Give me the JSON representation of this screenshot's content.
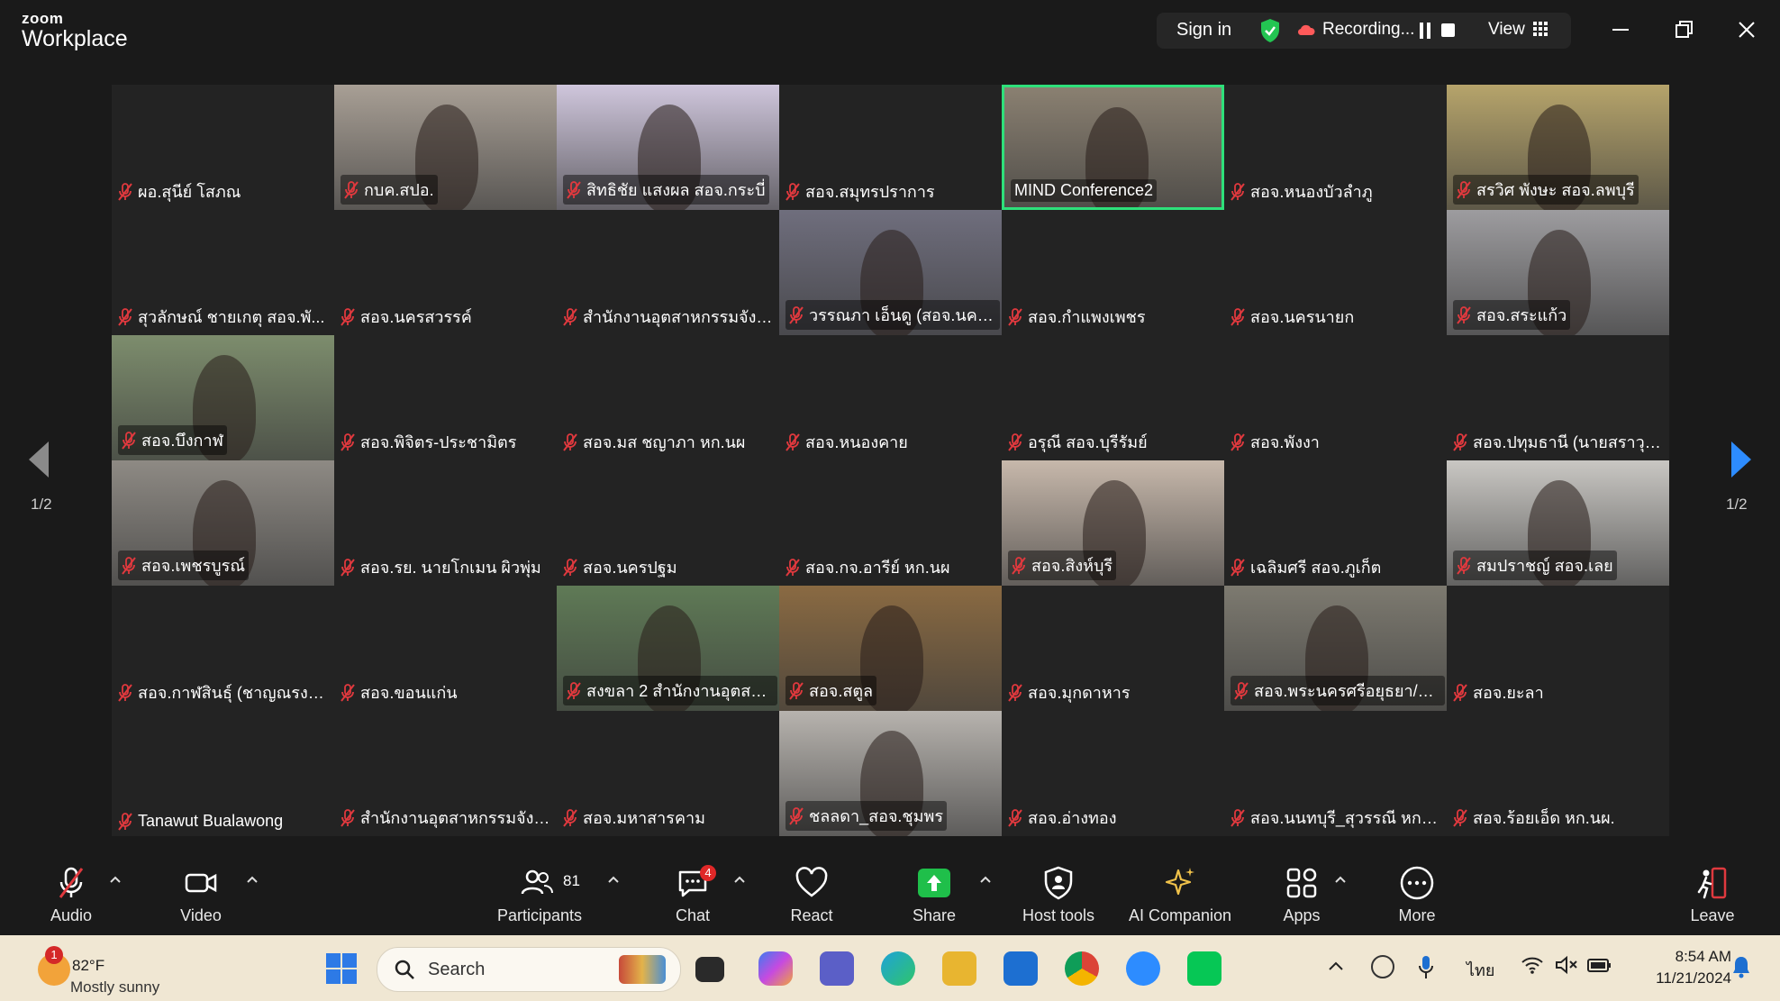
{
  "app": {
    "brand_small": "zoom",
    "brand_large": "Workplace"
  },
  "topbar": {
    "sign_in": "Sign in",
    "recording": "Recording...",
    "view": "View"
  },
  "colors": {
    "active_border": "#2ee07a",
    "mic_muted": "#e0393e",
    "share_green": "#1fbf4a",
    "accent_blue": "#2d8cff"
  },
  "gallery": {
    "page": "1/2",
    "tiles": [
      {
        "name": "ผอ.สุนีย์ โสภณ",
        "video": false
      },
      {
        "name": "กบค.สปอ.",
        "video": true,
        "bg": "#a89f95"
      },
      {
        "name": "สิทธิชัย  แสงผล สอจ.กระบี่",
        "video": true,
        "bg": "#cfc6dc"
      },
      {
        "name": "สอจ.สมุทรปราการ",
        "video": false
      },
      {
        "name": "MIND Conference2",
        "video": true,
        "bg": "#8a8071",
        "active": true,
        "nomic": true
      },
      {
        "name": "สอจ.หนองบัวลำภู",
        "video": false
      },
      {
        "name": "สรวิศ พังษะ สอจ.ลพบุรี",
        "video": true,
        "bg": "#b6a46b"
      },
      {
        "name": "สุวลักษณ์ ชายเกตุ สอจ.พั...",
        "video": false
      },
      {
        "name": "สอจ.นครสวรรค์",
        "video": false
      },
      {
        "name": "สำนักงานอุตสาหกรรมจังห...",
        "video": false
      },
      {
        "name": "วรรณภา เอ็นดู (สอจ.นคร...",
        "video": true,
        "bg": "#6f6e7d"
      },
      {
        "name": "สอจ.กำแพงเพชร",
        "video": false
      },
      {
        "name": "สอจ.นครนายก",
        "video": false
      },
      {
        "name": "สอจ.สระแก้ว",
        "video": true,
        "bg": "#9d9c9f"
      },
      {
        "name": "สอจ.บึงกาฬ",
        "video": true,
        "bg": "#7d8d6d"
      },
      {
        "name": "สอจ.พิจิตร-ประชามิตร",
        "video": false
      },
      {
        "name": "สอจ.มส ชญาภา หก.นผ",
        "video": false
      },
      {
        "name": "สอจ.หนองคาย",
        "video": false
      },
      {
        "name": "อรุณี สอจ.บุรีรัมย์",
        "video": false
      },
      {
        "name": "สอจ.พังงา",
        "video": false
      },
      {
        "name": "สอจ.ปทุมธานี (นายสราวุธ ...",
        "video": false
      },
      {
        "name": "สอจ.เพชรบูรณ์",
        "video": true,
        "bg": "#8e8a84"
      },
      {
        "name": "สอจ.รย. นายโกเมน ผิวพุ่ม",
        "video": false
      },
      {
        "name": "สอจ.นครปฐม",
        "video": false
      },
      {
        "name": "สอจ.กจ.อารีย์ หก.นผ",
        "video": false
      },
      {
        "name": "สอจ.สิงห์บุรี",
        "video": true,
        "bg": "#c7b8ab"
      },
      {
        "name": "เฉลิมศรี สอจ.ภูเก็ต",
        "video": false
      },
      {
        "name": "สมปราชญ์ สอจ.เลย",
        "video": true,
        "bg": "#c9c7c3"
      },
      {
        "name": "สอจ.กาฬสินธุ์ (ชาญณรงค์...",
        "video": false
      },
      {
        "name": "สอจ.ขอนแก่น",
        "video": false
      },
      {
        "name": "สงขลา 2 สำนักงานอุตสาห...",
        "video": true,
        "bg": "#5f7a56"
      },
      {
        "name": "สอจ.สตูล",
        "video": true,
        "bg": "#8a6a42"
      },
      {
        "name": "สอจ.มุกดาหาร",
        "video": false
      },
      {
        "name": "สอจ.พระนครศรีอยุธยา/สา...",
        "video": true,
        "bg": "#7d7a70"
      },
      {
        "name": "สอจ.ยะลา",
        "video": false
      },
      {
        "name": "Tanawut Bualawong",
        "video": false
      },
      {
        "name": "สำนักงานอุตสาหกรรมจังห...",
        "video": false
      },
      {
        "name": "สอจ.มหาสารคาม",
        "video": false
      },
      {
        "name": "ชลลดา_สอจ.ชุมพร",
        "video": true,
        "bg": "#b7b3ae"
      },
      {
        "name": "สอจ.อ่างทอง",
        "video": false
      },
      {
        "name": "สอจ.นนทบุรี_สุวรรณี หก.นผ.",
        "video": false
      },
      {
        "name": "สอจ.ร้อยเอ็ด หก.นผ.",
        "video": false
      }
    ]
  },
  "toolbar": {
    "audio": "Audio",
    "video": "Video",
    "participants": "Participants",
    "participants_count": "81",
    "chat": "Chat",
    "chat_badge": "4",
    "react": "React",
    "share": "Share",
    "host_tools": "Host tools",
    "ai_companion": "AI Companion",
    "apps": "Apps",
    "more": "More",
    "leave": "Leave"
  },
  "taskbar": {
    "weather_badge": "1",
    "temperature": "82°F",
    "weather": "Mostly sunny",
    "search_placeholder": "Search",
    "language": "ไทย",
    "time": "8:54 AM",
    "date": "11/21/2024"
  }
}
